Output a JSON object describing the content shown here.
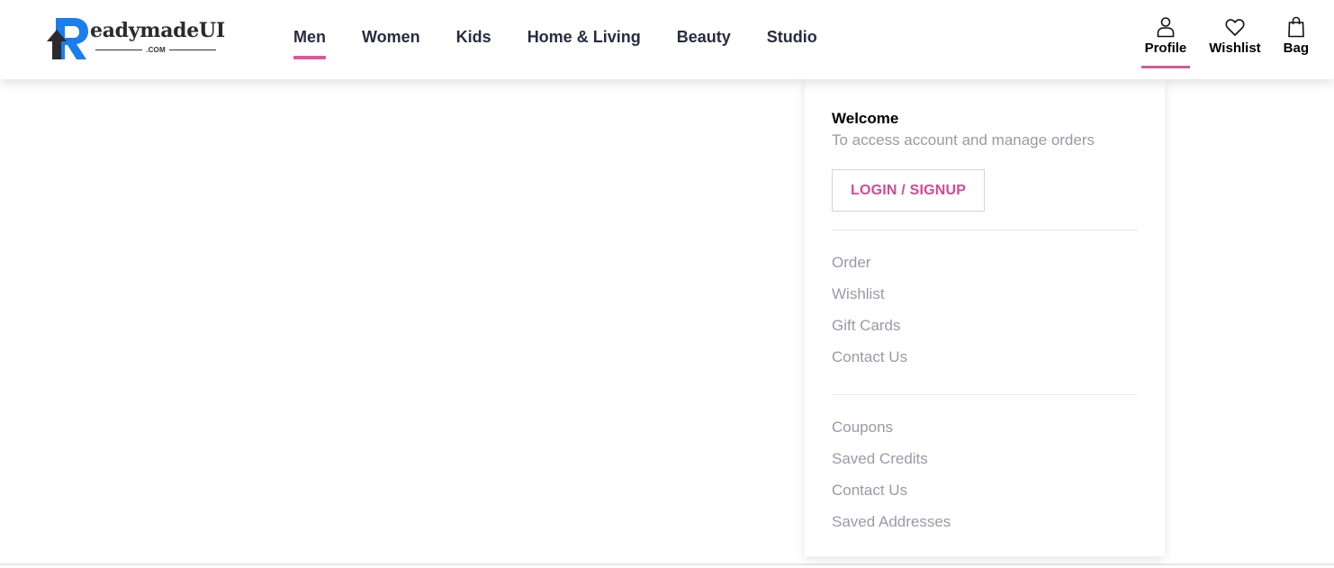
{
  "brand": {
    "name": "ReadymadeUI",
    "logo_text": "eadymadeUI",
    "logo_letter": "R",
    "logo_suffix": ".COM",
    "colors": {
      "primary_blue": "#1a7df0",
      "dark": "#2b2b2b",
      "accent_pink": "#e0559a"
    }
  },
  "nav": {
    "items": [
      {
        "label": "Men",
        "active": true
      },
      {
        "label": "Women",
        "active": false
      },
      {
        "label": "Kids",
        "active": false
      },
      {
        "label": "Home & Living",
        "active": false
      },
      {
        "label": "Beauty",
        "active": false
      },
      {
        "label": "Studio",
        "active": false
      }
    ]
  },
  "actions": {
    "profile": {
      "label": "Profile",
      "icon": "user-icon",
      "active": true
    },
    "wishlist": {
      "label": "Wishlist",
      "icon": "heart-icon"
    },
    "bag": {
      "label": "Bag",
      "icon": "shopping-bag-icon"
    }
  },
  "profile_menu": {
    "welcome_title": "Welcome",
    "welcome_subtitle": "To access account and manage orders",
    "login_button": "LOGIN / SIGNUP",
    "group1": [
      "Order",
      "Wishlist",
      "Gift Cards",
      "Contact Us"
    ],
    "group2": [
      "Coupons",
      "Saved Credits",
      "Contact Us",
      "Saved Addresses"
    ]
  }
}
